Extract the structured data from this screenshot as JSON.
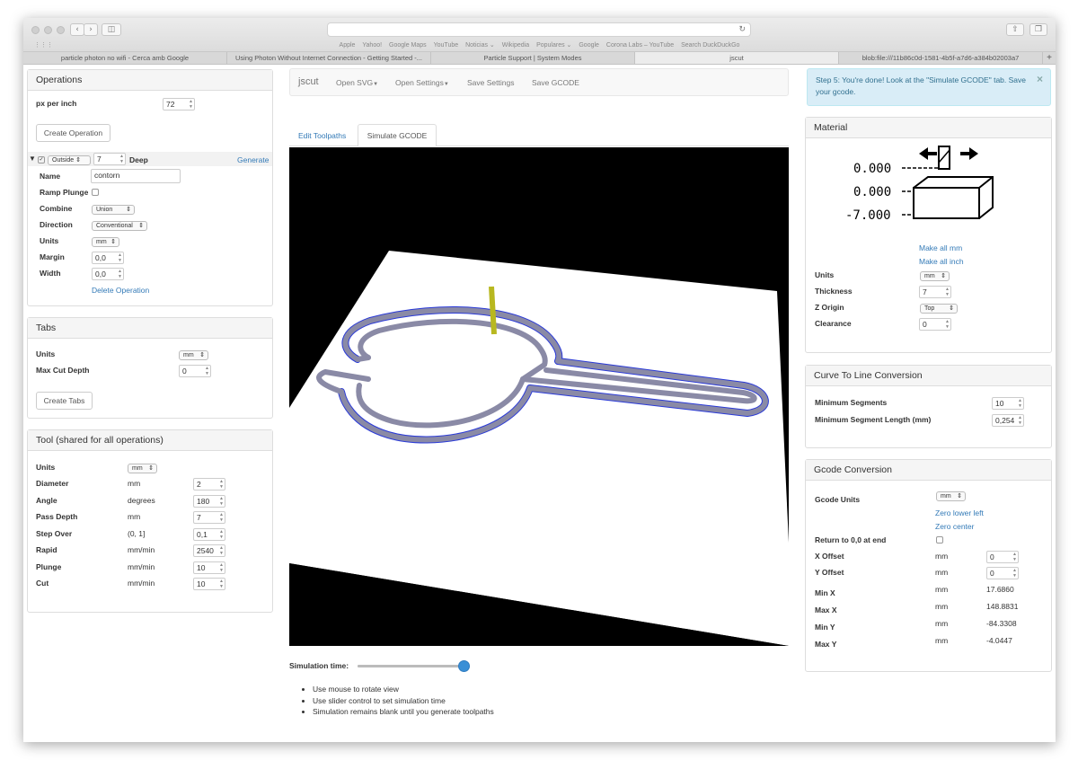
{
  "browser": {
    "bookmarks": [
      "Apple",
      "Yahoo!",
      "Google Maps",
      "YouTube",
      "Noticias ⌄",
      "Wikipedia",
      "Populares ⌄",
      "Google",
      "Corona Labs – YouTube",
      "Search DuckDuckGo"
    ],
    "tabs": [
      "particle photon no wifi - Cerca amb Google",
      "Using Photon Without Internet Connection - Getting Started -...",
      "Particle Support | System Modes",
      "jscut",
      "blob:file:///11b86c0d-1581-4b5f-a7d6-a384b02003a7"
    ],
    "new_tab": "+"
  },
  "operations": {
    "title": "Operations",
    "px_per_inch_label": "px per inch",
    "px_per_inch": "72",
    "create_label": "Create Operation",
    "op": {
      "type": "Outside",
      "depth": "7",
      "deep_label": "Deep",
      "generate_label": "Generate",
      "name_label": "Name",
      "name": "contorn",
      "ramp_label": "Ramp Plunge",
      "combine_label": "Combine",
      "combine": "Union",
      "direction_label": "Direction",
      "direction": "Conventional",
      "units_label": "Units",
      "units": "mm",
      "margin_label": "Margin",
      "margin": "0,0",
      "width_label": "Width",
      "width": "0,0",
      "delete_label": "Delete Operation"
    }
  },
  "tabs_panel": {
    "title": "Tabs",
    "units_label": "Units",
    "units": "mm",
    "max_cut_label": "Max Cut Depth",
    "max_cut": "0",
    "create_label": "Create Tabs"
  },
  "tool": {
    "title": "Tool (shared for all operations)",
    "units_label": "Units",
    "units": "mm",
    "rows": [
      {
        "label": "Diameter",
        "unit": "mm",
        "value": "2"
      },
      {
        "label": "Angle",
        "unit": "degrees",
        "value": "180"
      },
      {
        "label": "Pass Depth",
        "unit": "mm",
        "value": "7"
      },
      {
        "label": "Step Over",
        "unit": "(0, 1]",
        "value": "0,1"
      },
      {
        "label": "Rapid",
        "unit": "mm/min",
        "value": "2540"
      },
      {
        "label": "Plunge",
        "unit": "mm/min",
        "value": "10"
      },
      {
        "label": "Cut",
        "unit": "mm/min",
        "value": "10"
      }
    ]
  },
  "navbar": {
    "brand": "jscut",
    "items": [
      "Open SVG",
      "Open Settings",
      "Save Settings",
      "Save GCODE"
    ]
  },
  "view_tabs": [
    "Edit Toolpaths",
    "Simulate GCODE"
  ],
  "simulation": {
    "time_label": "Simulation time:",
    "slider_value": 1.0,
    "notes": [
      "Use mouse to rotate view",
      "Use slider control to set simulation time",
      "Simulation remains blank until you generate toolpaths"
    ]
  },
  "alert": {
    "text": "Step 5: You're done! Look at the \"Simulate GCODE\" tab. Save your gcode.",
    "close": "×"
  },
  "material": {
    "title": "Material",
    "diagram_values": [
      "0.000",
      "0.000",
      "-7.000"
    ],
    "make_mm": "Make all mm",
    "make_inch": "Make all inch",
    "units_label": "Units",
    "units": "mm",
    "thickness_label": "Thickness",
    "thickness": "7",
    "zorigin_label": "Z Origin",
    "zorigin": "Top",
    "clearance_label": "Clearance",
    "clearance": "0"
  },
  "curve": {
    "title": "Curve To Line Conversion",
    "min_seg_label": "Minimum Segments",
    "min_seg": "10",
    "min_len_label": "Minimum Segment Length (mm)",
    "min_len": "0,254"
  },
  "gcode": {
    "title": "Gcode Conversion",
    "units_label": "Gcode Units",
    "units": "mm",
    "zero_ll": "Zero lower left",
    "zero_c": "Zero center",
    "return_label": "Return to 0,0 at end",
    "xoff_label": "X Offset",
    "yoff_label": "Y Offset",
    "off_unit": "mm",
    "xoff": "0",
    "yoff": "0",
    "bounds": [
      {
        "label": "Min X",
        "unit": "mm",
        "value": "17.6860"
      },
      {
        "label": "Max X",
        "unit": "mm",
        "value": "148.8831"
      },
      {
        "label": "Min Y",
        "unit": "mm",
        "value": "-84.3308"
      },
      {
        "label": "Max Y",
        "unit": "mm",
        "value": "-4.0447"
      }
    ]
  },
  "colors": {
    "link": "#337ab7",
    "alert_bg": "#d9edf7",
    "toolpath": "#8a8aa6",
    "tool": "#b8b820",
    "edge": "#2a3ad8"
  }
}
